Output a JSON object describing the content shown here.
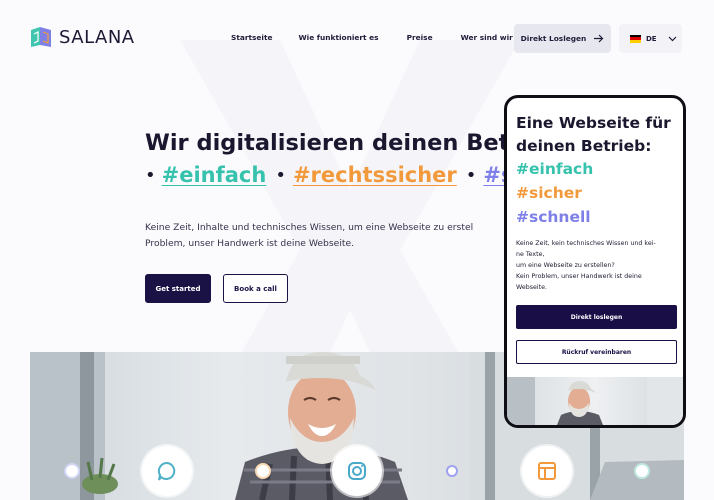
{
  "brand": {
    "name": "SALANA"
  },
  "nav": {
    "items": [
      "Startseite",
      "Wie funktioniert es",
      "Preise",
      "Wer sind wir"
    ],
    "cta_label": "Direkt Loslegen",
    "language": "DE"
  },
  "hero": {
    "title": "Wir digitalisieren deinen Betrieb:",
    "tags": [
      "#einfach",
      "#rechtssicher",
      "#sc"
    ],
    "description": "Keine Zeit, Inhalte und technisches Wissen, um eine Webseite zu erstel Problem, unser Handwerk ist deine Webseite.",
    "primary_button": "Get started",
    "secondary_button": "Book a call"
  },
  "phone": {
    "title": "Eine Webseite für deinen Betrieb:",
    "tags": [
      "#einfach",
      "#sicher",
      "#schnell"
    ],
    "description_lines": [
      "Keine Zeit, kein technisches Wissen und kei-",
      "ne Texte,",
      "um eine Webseite zu erstellen?",
      "Kein Problem, unser Handwerk ist deine",
      "Webseite."
    ],
    "primary_button": "Direkt loslegen",
    "secondary_button": "Rückruf vereinbaren"
  },
  "colors": {
    "teal": "#36c2ad",
    "orange": "#f29a3b",
    "violet": "#7e80e8",
    "navy": "#1a1245"
  },
  "icons": [
    "chat-icon",
    "instagram-icon",
    "layout-icon",
    "arrow-right-icon",
    "chevron-down-icon",
    "german-flag-icon"
  ]
}
